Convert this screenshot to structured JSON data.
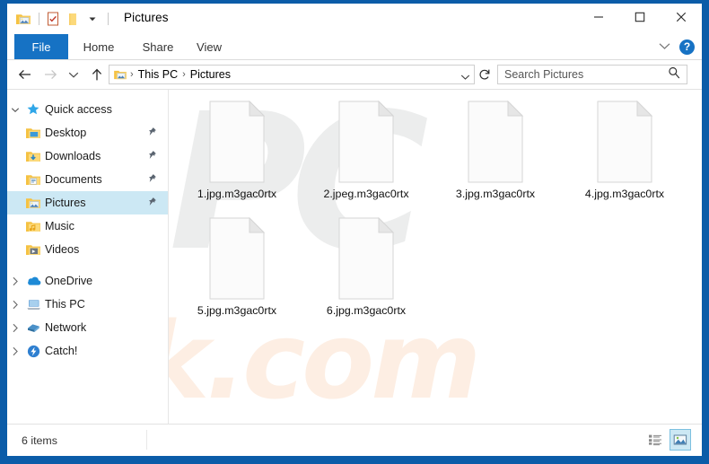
{
  "window": {
    "title": "Pictures",
    "icon": "pictures-folder-icon",
    "quick_access_toolbar": [
      {
        "name": "pictures-folder-icon",
        "label": "Pictures"
      },
      {
        "name": "properties-icon",
        "label": "Properties"
      },
      {
        "name": "new-folder-icon",
        "label": "New folder"
      },
      {
        "name": "customize-dropdown-icon",
        "label": "Customize Quick Access Toolbar"
      }
    ],
    "controls": {
      "minimize": "–",
      "maximize": "☐",
      "close": "✕"
    }
  },
  "ribbon": {
    "tabs": [
      {
        "label": "File",
        "active": true
      },
      {
        "label": "Home",
        "active": false
      },
      {
        "label": "Share",
        "active": false
      },
      {
        "label": "View",
        "active": false
      }
    ],
    "expand_icon": "chevron-down-icon",
    "help_label": "?"
  },
  "addressbar": {
    "back_icon": "back-arrow-icon",
    "forward_icon": "forward-arrow-icon",
    "recent_icon": "recent-locations-icon",
    "up_icon": "up-arrow-icon",
    "folder_icon": "pictures-folder-icon",
    "crumbs": [
      "This PC",
      "Pictures"
    ],
    "separator": "›",
    "dropdown_icon": "chevron-down-icon",
    "refresh_icon": "refresh-icon"
  },
  "search": {
    "placeholder": "Search Pictures",
    "icon": "search-icon"
  },
  "sidebar": {
    "items": [
      {
        "label": "Quick access",
        "icon": "star-icon",
        "expanded": true,
        "level": 1,
        "pinned": false,
        "selected": false
      },
      {
        "label": "Desktop",
        "icon": "desktop-folder-icon",
        "level": 2,
        "pinned": true,
        "selected": false
      },
      {
        "label": "Downloads",
        "icon": "downloads-folder-icon",
        "level": 2,
        "pinned": true,
        "selected": false
      },
      {
        "label": "Documents",
        "icon": "documents-folder-icon",
        "level": 2,
        "pinned": true,
        "selected": false
      },
      {
        "label": "Pictures",
        "icon": "pictures-folder-icon",
        "level": 2,
        "pinned": true,
        "selected": true
      },
      {
        "label": "Music",
        "icon": "music-folder-icon",
        "level": 2,
        "pinned": false,
        "selected": false
      },
      {
        "label": "Videos",
        "icon": "videos-folder-icon",
        "level": 2,
        "pinned": false,
        "selected": false
      },
      {
        "label": "OneDrive",
        "icon": "onedrive-cloud-icon",
        "expanded": false,
        "level": 1,
        "pinned": false,
        "selected": false
      },
      {
        "label": "This PC",
        "icon": "this-pc-icon",
        "expanded": false,
        "level": 1,
        "pinned": false,
        "selected": false
      },
      {
        "label": "Network",
        "icon": "network-icon",
        "expanded": false,
        "level": 1,
        "pinned": false,
        "selected": false
      },
      {
        "label": "Catch!",
        "icon": "catch-icon",
        "expanded": false,
        "level": 1,
        "pinned": false,
        "selected": false
      }
    ]
  },
  "files": [
    {
      "name": "1.jpg.m3gac0rtx",
      "icon": "blank-document-icon"
    },
    {
      "name": "2.jpeg.m3gac0rtx",
      "icon": "blank-document-icon"
    },
    {
      "name": "3.jpg.m3gac0rtx",
      "icon": "blank-document-icon"
    },
    {
      "name": "4.jpg.m3gac0rtx",
      "icon": "blank-document-icon"
    },
    {
      "name": "5.jpg.m3gac0rtx",
      "icon": "blank-document-icon"
    },
    {
      "name": "6.jpg.m3gac0rtx",
      "icon": "blank-document-icon"
    }
  ],
  "statusbar": {
    "item_count": "6 items",
    "views": [
      {
        "name": "details-view-button",
        "active": false
      },
      {
        "name": "large-icons-view-button",
        "active": true
      }
    ]
  },
  "watermark": {
    "top": "PC",
    "bottom": "risk.com"
  },
  "colors": {
    "window_border": "#0b5ca8",
    "accent": "#1672c4",
    "selection": "#cce8f4",
    "watermark_grey": "#eceded",
    "watermark_peach": "#fdeee3"
  }
}
